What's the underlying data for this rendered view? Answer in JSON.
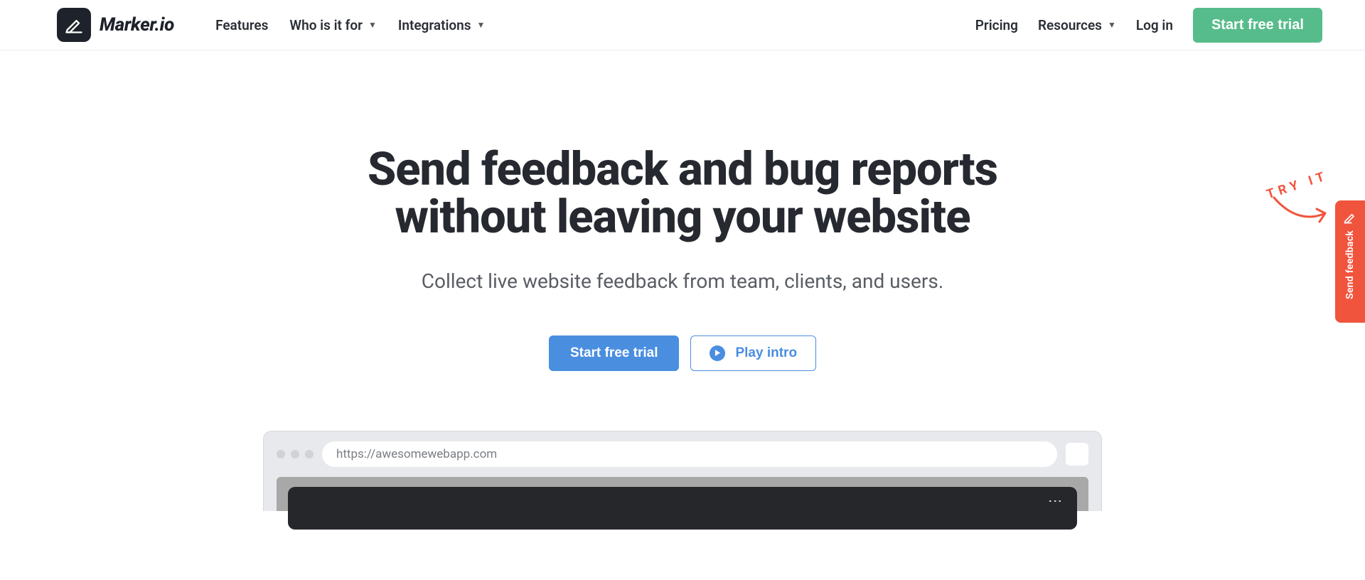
{
  "brand": {
    "name": "Marker.io"
  },
  "nav": {
    "left": [
      {
        "label": "Features",
        "dropdown": false
      },
      {
        "label": "Who is it for",
        "dropdown": true
      },
      {
        "label": "Integrations",
        "dropdown": true
      }
    ],
    "right": [
      {
        "label": "Pricing",
        "dropdown": false
      },
      {
        "label": "Resources",
        "dropdown": true
      },
      {
        "label": "Log in",
        "dropdown": false
      }
    ],
    "cta": "Start free trial"
  },
  "hero": {
    "title": "Send feedback and bug reports without leaving your website",
    "subtitle": "Collect live website feedback from team, clients, and users.",
    "primary_cta": "Start free trial",
    "secondary_cta": "Play intro"
  },
  "mock": {
    "url": "https://awesomewebapp.com"
  },
  "widget": {
    "label": "Send feedback",
    "hint": "TRY IT"
  }
}
